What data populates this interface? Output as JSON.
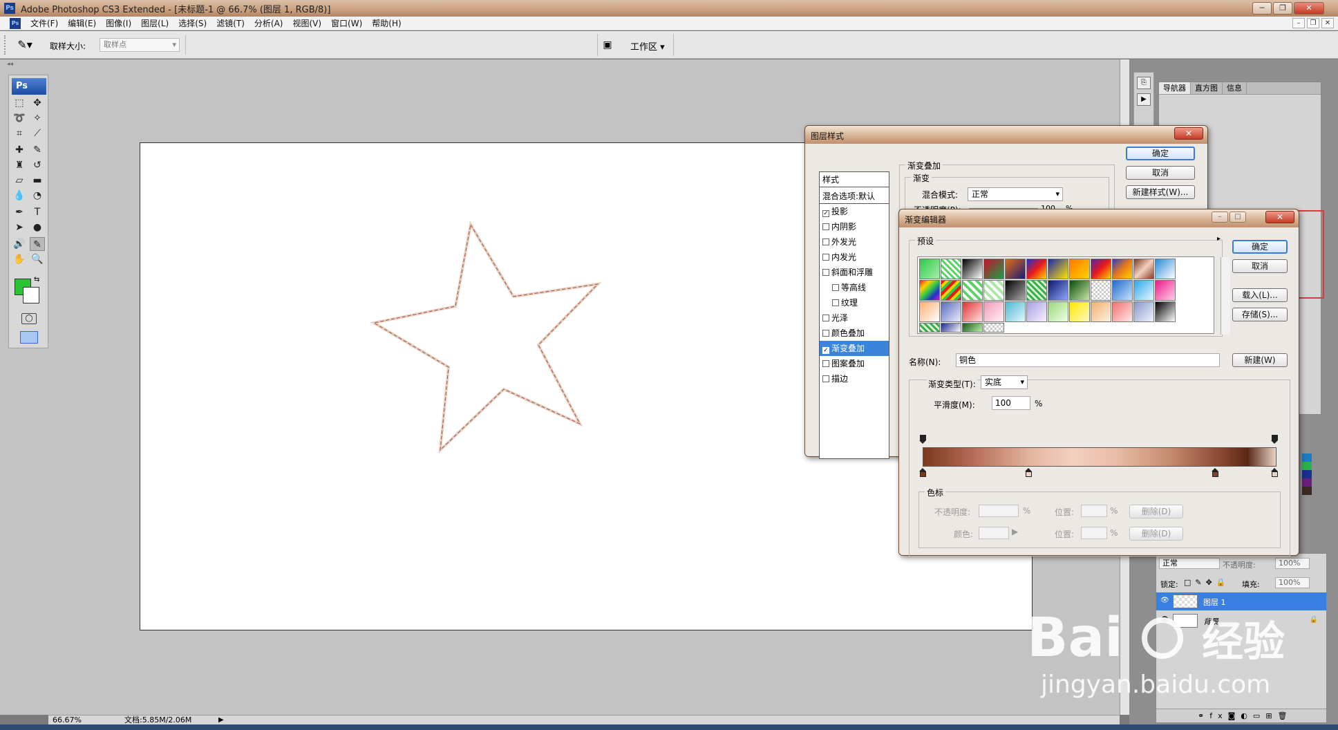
{
  "window": {
    "title": "Adobe Photoshop CS3 Extended - [未标题-1 @ 66.7% (图层 1, RGB/8)]",
    "app_icon": "Ps",
    "controls": [
      "─",
      "❐",
      "✕"
    ]
  },
  "menu": [
    "文件(F)",
    "编辑(E)",
    "图像(I)",
    "图层(L)",
    "选择(S)",
    "滤镜(T)",
    "分析(A)",
    "视图(V)",
    "窗口(W)",
    "帮助(H)"
  ],
  "options": {
    "sample_size_label": "取样大小:",
    "sample_size_value": "取样点",
    "workspace_label": "工作区 ▾"
  },
  "toolbox": {
    "logo": "Ps",
    "foreground_color": "#2dc238",
    "background_color": "#ffffff"
  },
  "status": {
    "zoom": "66.67%",
    "doc": "文档:5.85M/2.06M"
  },
  "navigator": {
    "tabs": [
      "导航器",
      "直方图",
      "信息"
    ]
  },
  "layers": {
    "blend_mode": "正常",
    "opacity_label": "不透明度:",
    "opacity_value": "100%",
    "lock_label": "锁定:",
    "fill_label": "填充:",
    "fill_value": "100%",
    "items": [
      {
        "name": "图层 1",
        "selected": true
      },
      {
        "name": "背景",
        "selected": false,
        "locked": true
      }
    ]
  },
  "layer_style": {
    "title": "图层样式",
    "list": [
      {
        "label": "样式",
        "head": true
      },
      {
        "label": "混合选项:默认",
        "head": true
      },
      {
        "label": "投影",
        "checked": true
      },
      {
        "label": "内阴影",
        "checked": false
      },
      {
        "label": "外发光",
        "checked": false
      },
      {
        "label": "内发光",
        "checked": false
      },
      {
        "label": "斜面和浮雕",
        "checked": false
      },
      {
        "label": "等高线",
        "checked": false,
        "indent": true
      },
      {
        "label": "纹理",
        "checked": false,
        "indent": true
      },
      {
        "label": "光泽",
        "checked": false
      },
      {
        "label": "颜色叠加",
        "checked": false
      },
      {
        "label": "渐变叠加",
        "checked": true,
        "selected": true
      },
      {
        "label": "图案叠加",
        "checked": false
      },
      {
        "label": "描边",
        "checked": false
      }
    ],
    "section_title": "渐变叠加",
    "sub_title": "渐变",
    "blend_mode_label": "混合模式:",
    "blend_mode_value": "正常",
    "opacity_label": "不透明度(P):",
    "opacity_value": "100",
    "opacity_unit": "%",
    "buttons": {
      "ok": "确定",
      "cancel": "取消",
      "new_style": "新建样式(W)..."
    }
  },
  "gradient_editor": {
    "title": "渐变编辑器",
    "presets_label": "预设",
    "name_label": "名称(N):",
    "name_value": "铜色",
    "new_button": "新建(W)",
    "type_label": "渐变类型(T):",
    "type_value": "实底",
    "smoothness_label": "平滑度(M):",
    "smoothness_value": "100",
    "smoothness_unit": "%",
    "stops_label": "色标",
    "opacity_label": "不透明度:",
    "location_label": "位置:",
    "color_label": "颜色:",
    "percent": "%",
    "delete_button": "删除(D)",
    "buttons": {
      "ok": "确定",
      "cancel": "取消",
      "load": "载入(L)...",
      "save": "存储(S)..."
    },
    "gradient_colors": [
      "#7b3a1e",
      "#e2b49e",
      "#f3d0c0",
      "#82402a",
      "#e9d2c4"
    ]
  },
  "watermark": {
    "brand": "Bai",
    "brand_cn": "经验",
    "url": "jingyan.baidu.com"
  }
}
